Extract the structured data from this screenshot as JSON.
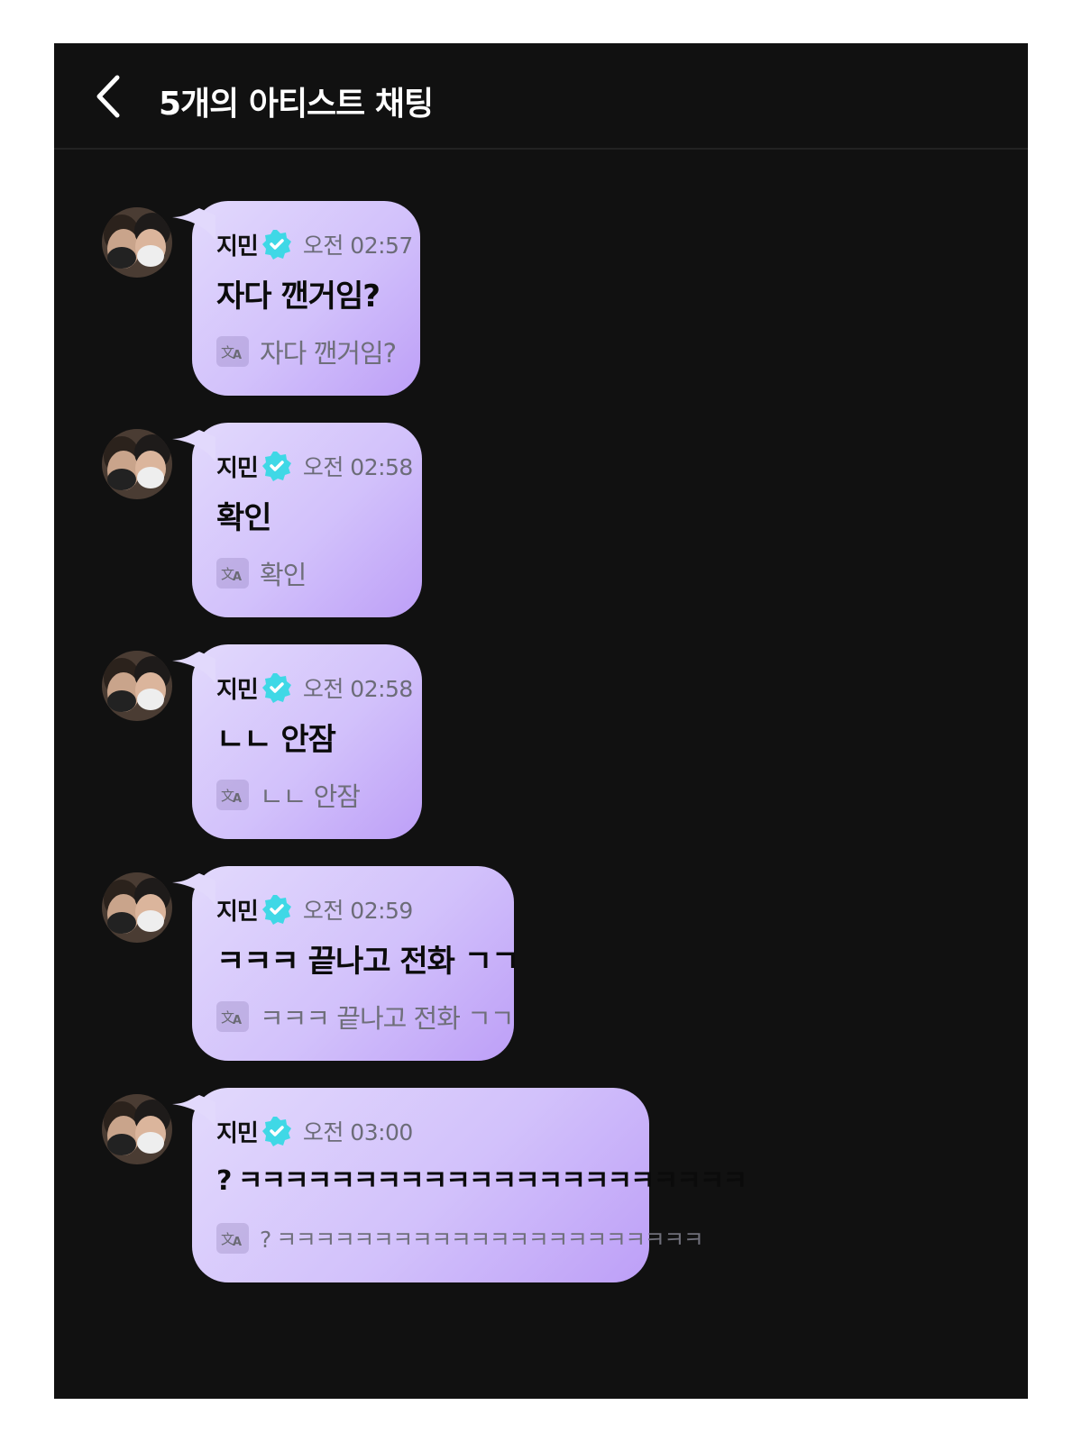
{
  "header": {
    "back_icon": "chevron-left-icon",
    "title": "5개의 아티스트 채팅"
  },
  "colors": {
    "background": "#111111",
    "bubble_gradient_start": "#e2d9fc",
    "bubble_gradient_end": "#bd9ff7",
    "verified_badge": "#3fd8e6"
  },
  "messages": [
    {
      "sender": "지민",
      "badge_icon": "verified-badge-icon",
      "time": "오전 02:57",
      "text": "자다 깬거임?",
      "translate_icon": "translate-icon",
      "translation": "자다 깬거임?"
    },
    {
      "sender": "지민",
      "badge_icon": "verified-badge-icon",
      "time": "오전 02:58",
      "text": "확인",
      "translate_icon": "translate-icon",
      "translation": "확인"
    },
    {
      "sender": "지민",
      "badge_icon": "verified-badge-icon",
      "time": "오전 02:58",
      "text": "ㄴㄴ 안잠",
      "translate_icon": "translate-icon",
      "translation": "ㄴㄴ 안잠"
    },
    {
      "sender": "지민",
      "badge_icon": "verified-badge-icon",
      "time": "오전 02:59",
      "text": "ㅋㅋㅋ 끝나고 전화 ㄱㄱ",
      "translate_icon": "translate-icon",
      "translation": "ㅋㅋㅋ 끝나고 전화 ㄱㄱ"
    },
    {
      "sender": "지민",
      "badge_icon": "verified-badge-icon",
      "time": "오전 03:00",
      "text": "? ㅋㅋㅋㅋㅋㅋㅋㅋㅋㅋㅋㅋㅋㅋㅋㅋㅋㅋㅋㅋㅋㅋ",
      "translate_icon": "translate-icon",
      "translation": "? ㅋㅋㅋㅋㅋㅋㅋㅋㅋㅋㅋㅋㅋㅋㅋㅋㅋㅋㅋㅋㅋㅋ"
    }
  ]
}
